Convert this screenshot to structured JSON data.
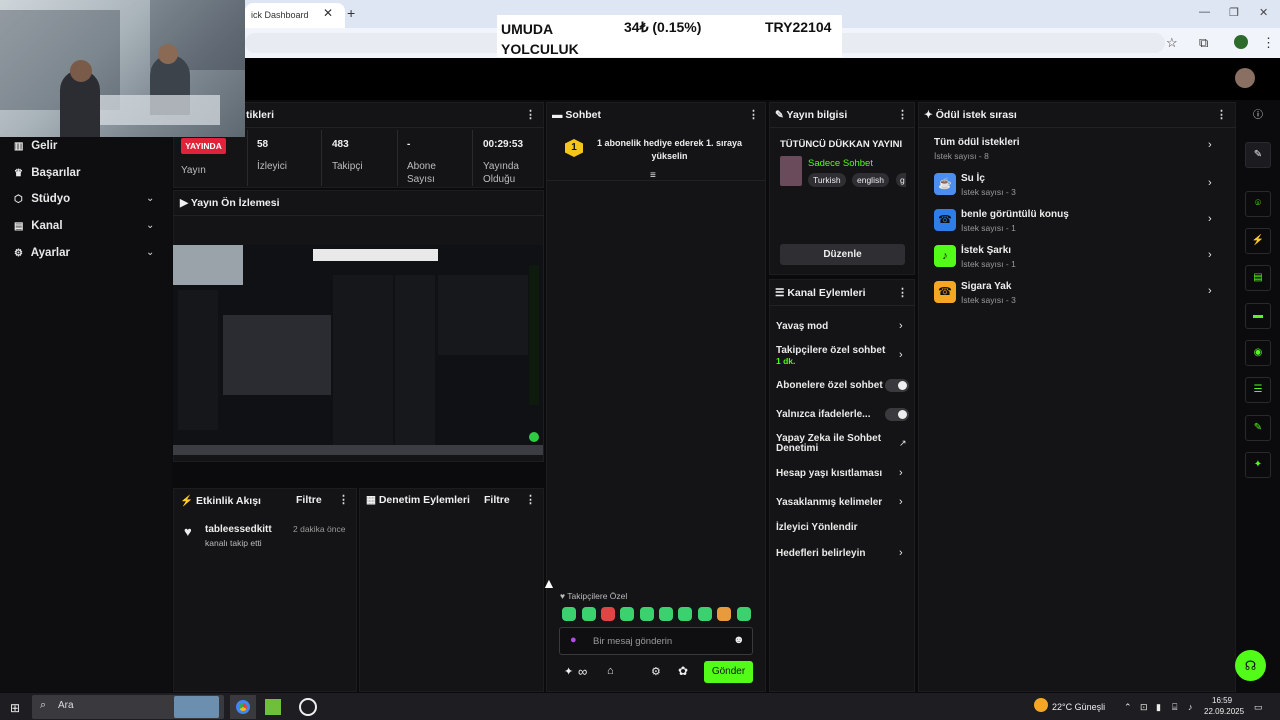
{
  "browser": {
    "tab_title": "ick Dashboard",
    "tab_close": "✕",
    "new_tab": "+",
    "window_controls": [
      "—",
      "❐",
      "✕"
    ]
  },
  "ticker": {
    "name": "UMUDA YOLCULUK",
    "price": "34₺ (0.15%)",
    "code": "TRY22104"
  },
  "sidebar": {
    "items": [
      {
        "label": "Gelir",
        "icon": "chart-icon",
        "chevron": false
      },
      {
        "label": "Başarılar",
        "icon": "trophy-icon",
        "chevron": false
      },
      {
        "label": "Stüdyo",
        "icon": "studio-icon",
        "chevron": true
      },
      {
        "label": "Kanal",
        "icon": "channel-icon",
        "chevron": true
      },
      {
        "label": "Ayarlar",
        "icon": "gear-icon",
        "chevron": true
      }
    ]
  },
  "stats": {
    "title": "tikleri",
    "live_badge": "YAYINDA",
    "live_label": "Yayın",
    "viewers_value": "58",
    "viewers_label": "İzleyici",
    "followers_value": "483",
    "followers_label": "Takipçi",
    "subs_value": "-",
    "subs_label": "Abone Sayısı",
    "uptime_value": "00:29:53",
    "uptime_label": "Yayında Olduğu"
  },
  "preview": {
    "title": "Yayın Ön İzlemesi"
  },
  "activity": {
    "title": "Etkinlik Akışı",
    "filter": "Filtre",
    "event_user": "tableessedkitt",
    "event_time": "2 dakika önce",
    "event_desc": "kanalı takip etti"
  },
  "moderation": {
    "title": "Denetim Eylemleri",
    "filter": "Filtre"
  },
  "chat": {
    "title": "Sohbet",
    "gift_rank": "1",
    "gift_message": "1 abonelik hediye ederek 1. sıraya yükselin",
    "mode_label": "Takipçilere Özel",
    "input_placeholder": "Bir mesaj gönderin",
    "infinity": "∞",
    "send_label": "Gönder"
  },
  "stream_info": {
    "title": "Yayın bilgisi",
    "stream_title": "TÜTÜNCÜ DÜKKAN YAYINI",
    "category": "Sadece Sohbet",
    "tags": [
      "Turkish",
      "english",
      "g"
    ],
    "edit_label": "Düzenle"
  },
  "channel_actions": {
    "title": "Kanal Eylemleri",
    "items": [
      {
        "label": "Yavaş mod",
        "sub": "",
        "control": "chevron"
      },
      {
        "label": "Takipçilere özel sohbet",
        "sub": "1 dk.",
        "control": "chevron"
      },
      {
        "label": "Abonelere özel sohbet",
        "sub": "",
        "control": "toggle"
      },
      {
        "label": "Yalnızca ifadelerle...",
        "sub": "",
        "control": "toggle"
      },
      {
        "label": "Yapay Zeka ile Sohbet Denetimi",
        "sub": "",
        "control": "external"
      },
      {
        "label": "Hesap yaşı kısıtlaması",
        "sub": "",
        "control": "chevron"
      },
      {
        "label": "Yasaklanmış kelimeler",
        "sub": "",
        "control": "chevron"
      },
      {
        "label": "İzleyici Yönlendir",
        "sub": "",
        "control": "none"
      },
      {
        "label": "Hedefleri belirleyin",
        "sub": "",
        "control": "chevron"
      }
    ]
  },
  "rewards": {
    "title": "Ödül istek sırası",
    "all_title": "Tüm ödül istekleri",
    "all_count": "İstek sayısı - 8",
    "items": [
      {
        "title": "Su İç",
        "count": "İstek sayısı - 3",
        "color": "#4b8ef0"
      },
      {
        "title": "benle görüntülü konuş",
        "count": "İstek sayısı - 1",
        "color": "#2f7ee8"
      },
      {
        "title": "İstek Şarkı",
        "count": "İstek sayısı - 1",
        "color": "#53fc18"
      },
      {
        "title": "Sigara Yak",
        "count": "İstek sayısı - 3",
        "color": "#f5a623"
      }
    ]
  },
  "taskbar": {
    "search_label": "Ara",
    "weather": "22°C  Güneşli",
    "time": "16:59",
    "date": "22.09.2025"
  },
  "colors": {
    "accent": "#53fc18",
    "live": "#e0223b",
    "panel": "#141416"
  }
}
